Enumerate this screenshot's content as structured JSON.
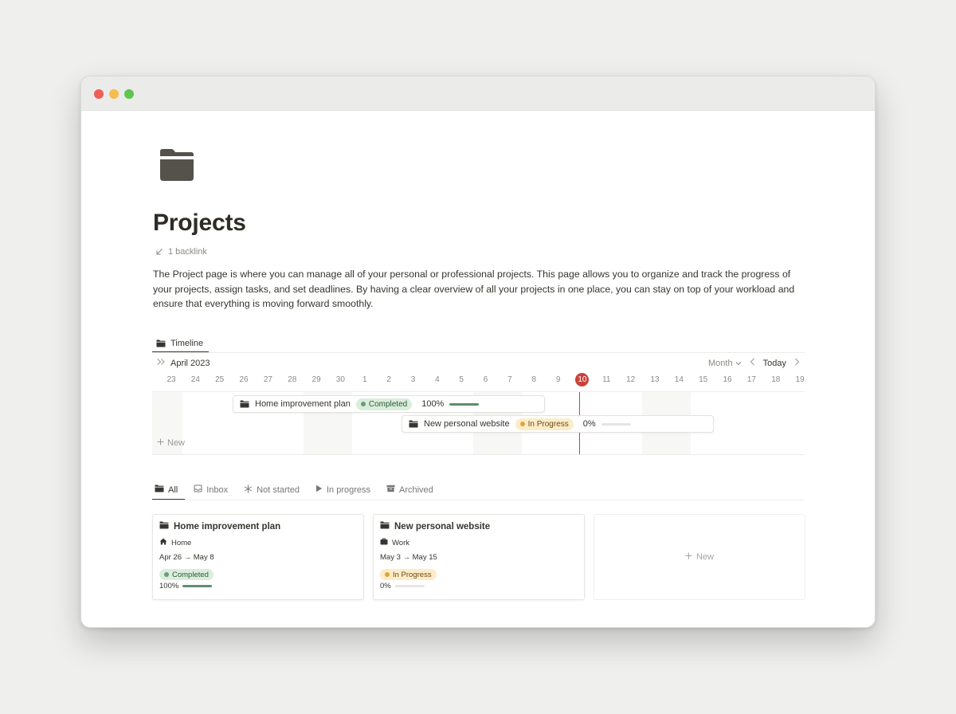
{
  "page": {
    "title": "Projects",
    "backlink": "1 backlink",
    "description": "The Project page is where you can manage all of your personal or professional projects. This page allows you to organize and track the progress of your projects, assign tasks, and set deadlines. By having a clear overview of all your projects in one place, you can stay on top of your workload and ensure that everything is moving forward smoothly."
  },
  "timeline": {
    "view_label": "Timeline",
    "month_label": "April 2023",
    "zoom_label": "Month",
    "today_label": "Today",
    "days": [
      "23",
      "24",
      "25",
      "26",
      "27",
      "28",
      "29",
      "30",
      "1",
      "2",
      "3",
      "4",
      "5",
      "6",
      "7",
      "8",
      "9",
      "10",
      "11",
      "12",
      "13",
      "14",
      "15",
      "16",
      "17",
      "18",
      "19"
    ],
    "today_day": "10",
    "new_label": "New",
    "items": [
      {
        "name": "Home improvement plan",
        "status": "Completed",
        "progress_label": "100%",
        "progress": 1.0
      },
      {
        "name": "New personal website",
        "status": "In Progress",
        "progress_label": "0%",
        "progress": 0.0
      }
    ]
  },
  "gallery": {
    "tabs": [
      "All",
      "Inbox",
      "Not started",
      "In progress",
      "Archived"
    ],
    "cards": [
      {
        "title": "Home improvement plan",
        "category": "Home",
        "dates": "Apr 26 → May 8",
        "status": "Completed",
        "progress_label": "100%",
        "progress": 1.0
      },
      {
        "title": "New personal website",
        "category": "Work",
        "dates": "May 3 → May 15",
        "status": "In Progress",
        "progress_label": "0%",
        "progress": 0.0
      }
    ],
    "new_label": "New"
  },
  "colors": {
    "accent_today": "#c8433a",
    "completed_bg": "#dbeddb",
    "in_progress_bg": "#fdecc8",
    "progress_fill": "#5f8c6e"
  }
}
